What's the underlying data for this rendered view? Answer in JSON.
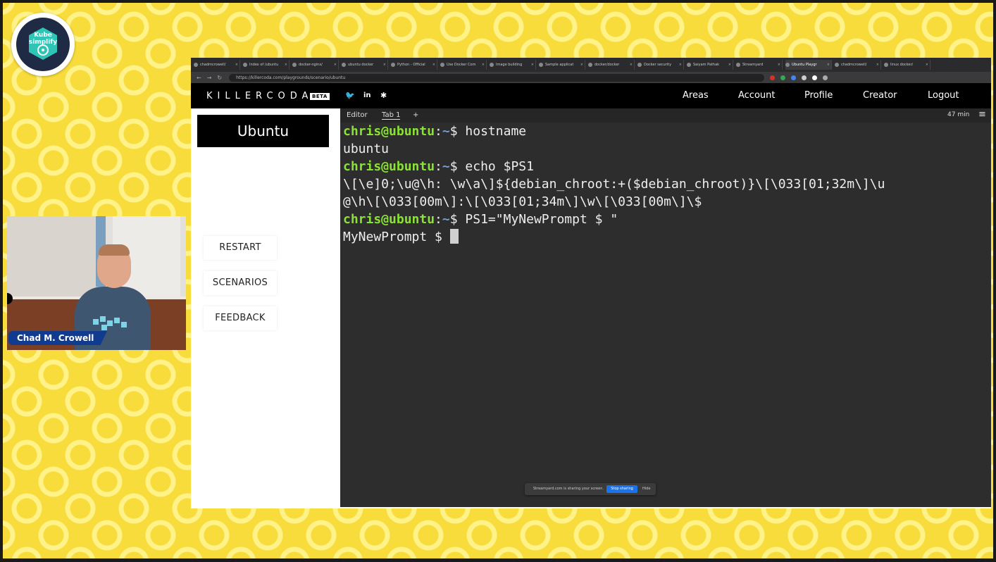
{
  "browser": {
    "tabs": [
      {
        "label": "chadmcrowell/"
      },
      {
        "label": "Index of /ubuntu"
      },
      {
        "label": "docker-nginx/"
      },
      {
        "label": "ubuntu docker"
      },
      {
        "label": "Python - Official"
      },
      {
        "label": "Use Docker Com"
      },
      {
        "label": "Image building"
      },
      {
        "label": "Sample applicat"
      },
      {
        "label": "docker/docker"
      },
      {
        "label": "Docker security"
      },
      {
        "label": "Saiyam Pathak"
      },
      {
        "label": "Streamyard"
      },
      {
        "label": "Ubuntu Playgr"
      },
      {
        "label": "chadmcrowell/"
      },
      {
        "label": "linux docker/"
      }
    ],
    "active_tab_index": 12,
    "url": "https://killercoda.com/playgrounds/scenario/ubuntu"
  },
  "header": {
    "brand": "KILLERCODA",
    "beta": "BETA",
    "social": [
      {
        "icon": "twitter-icon",
        "glyph": "🐦"
      },
      {
        "icon": "linkedin-icon",
        "glyph": "in"
      },
      {
        "icon": "slack-icon",
        "glyph": "✱"
      }
    ],
    "nav": [
      "Areas",
      "Account",
      "Profile",
      "Creator",
      "Logout"
    ]
  },
  "sidebar": {
    "title": "Ubuntu",
    "buttons": [
      "RESTART",
      "SCENARIOS",
      "FEEDBACK"
    ]
  },
  "terminal": {
    "tabs": {
      "editor": "Editor",
      "tab1": "Tab 1",
      "add": "+"
    },
    "timer": "47 min",
    "menu_icon": "≡",
    "lines": [
      {
        "user": "chris@ubuntu",
        "path": "~",
        "prompt": "$ ",
        "cmd": "hostname"
      },
      {
        "output": "ubuntu"
      },
      {
        "user": "chris@ubuntu",
        "path": "~",
        "prompt": "$ ",
        "cmd": "echo $PS1"
      },
      {
        "output": "\\[\\e]0;\\u@\\h: \\w\\a\\]${debian_chroot:+($debian_chroot)}\\[\\033[01;32m\\]\\u"
      },
      {
        "output": "@\\h\\[\\033[00m\\]:\\[\\033[01;34m\\]\\w\\[\\033[00m\\]\\$"
      },
      {
        "user": "chris@ubuntu",
        "path": "~",
        "prompt": "$ ",
        "cmd": "PS1=\"MyNewPrompt $ \""
      },
      {
        "output": "MyNewPrompt $ "
      }
    ]
  },
  "share_bar": {
    "text": "Streamyard.com is sharing your screen.",
    "stop_label": "Stop sharing",
    "hide_label": "Hide"
  },
  "webcam": {
    "name": "Chad M. Crowell"
  },
  "logo": {
    "line1": "Kube",
    "line2": "simplify"
  },
  "colors": {
    "background": "#f7dc3c",
    "terminal_bg": "#2d2d2d",
    "prompt_user": "#8ae234",
    "prompt_path": "#729fcf",
    "name_tag": "#113b8f"
  }
}
